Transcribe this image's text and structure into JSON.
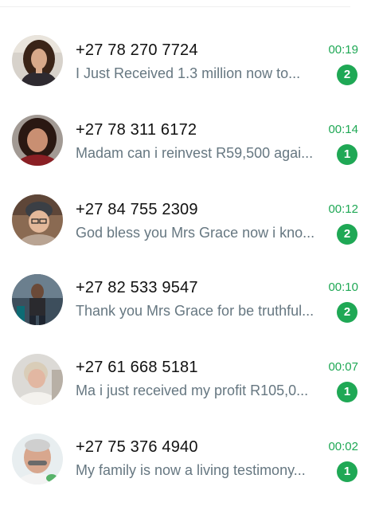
{
  "colors": {
    "accent_green": "#1fa855",
    "name_text": "#111111",
    "preview_text": "#667781",
    "background": "#ffffff"
  },
  "chats": [
    {
      "name": "+27 78 270 7724",
      "time": "00:19",
      "preview": "I Just Received 1.3 million now to...",
      "unread": "2",
      "avatar_icon": "contact-photo-icon"
    },
    {
      "name": "+27 78 311 6172",
      "time": "00:14",
      "preview": "Madam can i reinvest R59,500 agai...",
      "unread": "1",
      "avatar_icon": "contact-photo-icon"
    },
    {
      "name": "+27 84 755 2309",
      "time": "00:12",
      "preview": "God bless you Mrs Grace now i kno...",
      "unread": "2",
      "avatar_icon": "contact-photo-icon"
    },
    {
      "name": "+27 82 533 9547",
      "time": "00:10",
      "preview": "Thank you Mrs Grace for be truthful...",
      "unread": "2",
      "avatar_icon": "contact-photo-icon"
    },
    {
      "name": "+27 61 668 5181",
      "time": "00:07",
      "preview": "Ma i just received my profit R105,0...",
      "unread": "1",
      "avatar_icon": "contact-photo-icon"
    },
    {
      "name": "+27 75 376 4940",
      "time": "00:02",
      "preview": "My family is now a living testimony...",
      "unread": "1",
      "avatar_icon": "contact-photo-icon"
    }
  ]
}
